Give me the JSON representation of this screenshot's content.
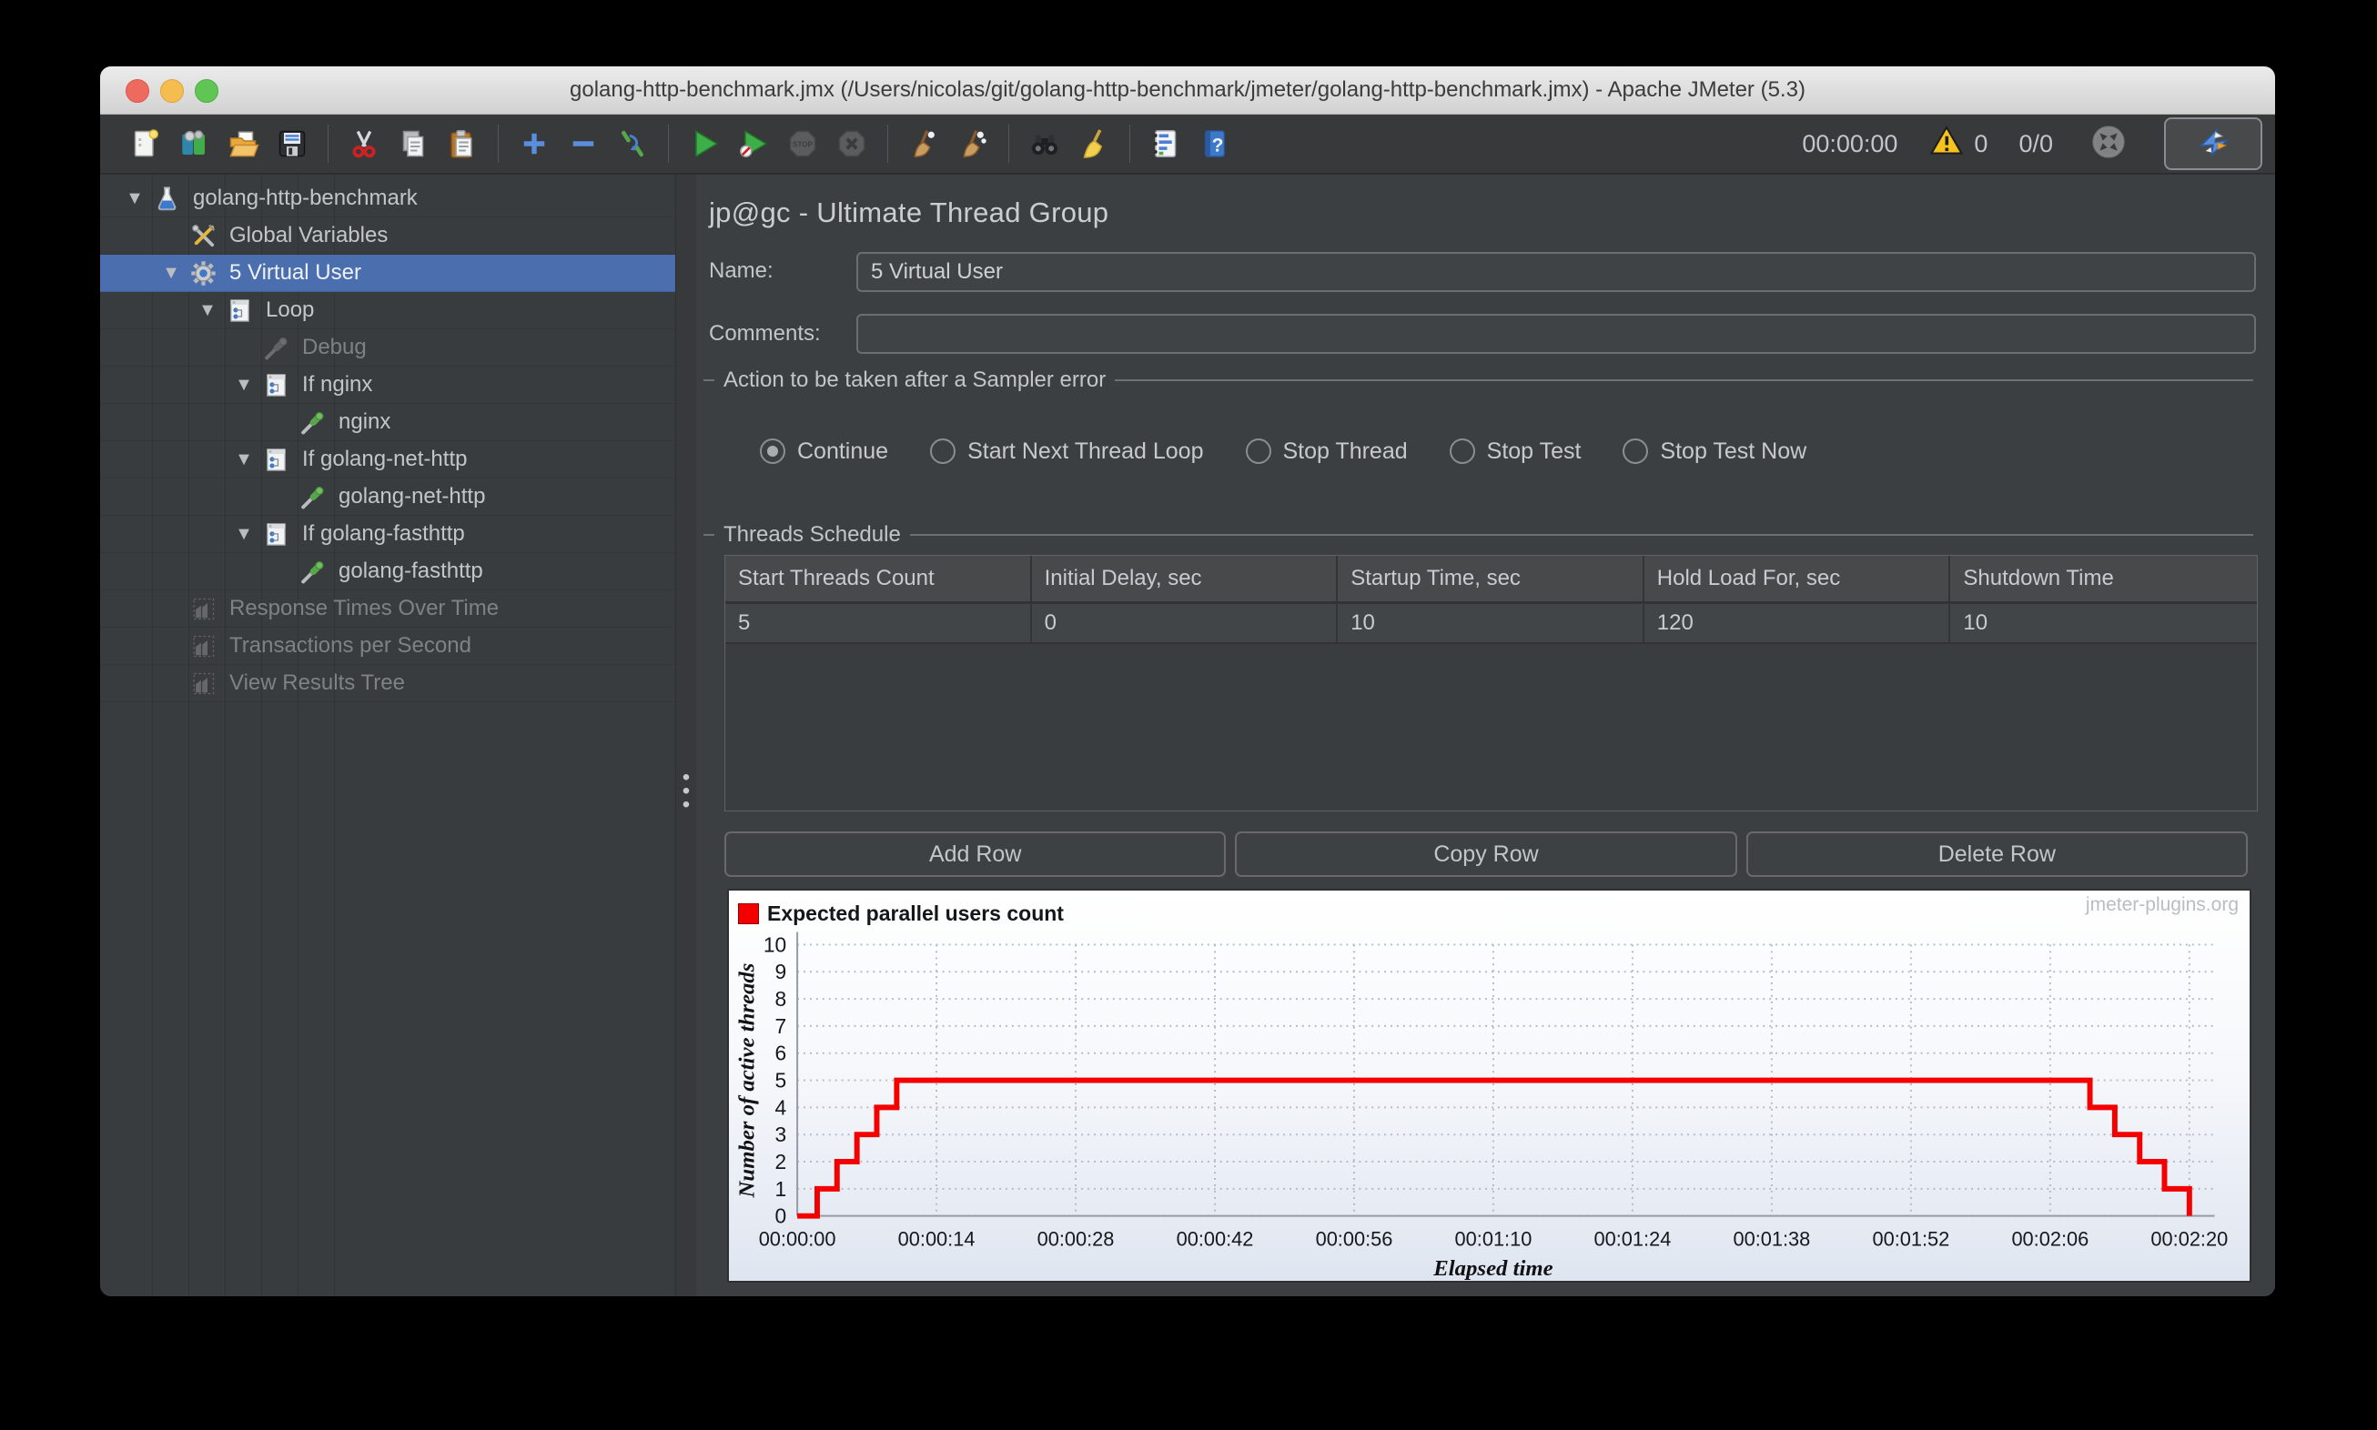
{
  "window": {
    "title": "golang-http-benchmark.jmx (/Users/nicolas/git/golang-http-benchmark/jmeter/golang-http-benchmark.jmx) - Apache JMeter (5.3)"
  },
  "toolbar": {
    "groups": [
      [
        {
          "name": "new-file"
        },
        {
          "name": "templates"
        },
        {
          "name": "open-file"
        },
        {
          "name": "save"
        }
      ],
      [
        {
          "name": "cut"
        },
        {
          "name": "copy"
        },
        {
          "name": "paste"
        }
      ],
      [
        {
          "name": "add"
        },
        {
          "name": "remove"
        },
        {
          "name": "toggle"
        }
      ],
      [
        {
          "name": "start"
        },
        {
          "name": "start-no-timers"
        },
        {
          "name": "stop",
          "disabled": true
        },
        {
          "name": "shutdown",
          "disabled": true
        }
      ],
      [
        {
          "name": "clear"
        },
        {
          "name": "clear-all"
        }
      ],
      [
        {
          "name": "search"
        },
        {
          "name": "search-reset"
        }
      ],
      [
        {
          "name": "function-helper"
        },
        {
          "name": "help"
        }
      ]
    ],
    "timer": "00:00:00",
    "warning_count": "0",
    "thread_counts": "0/0"
  },
  "tree": {
    "items": [
      {
        "label": "golang-http-benchmark",
        "icon": "test-plan-icon",
        "depth": 0,
        "expandable": true
      },
      {
        "label": "Global Variables",
        "icon": "arguments-icon",
        "depth": 1
      },
      {
        "label": "5 Virtual User",
        "icon": "thread-group-icon",
        "depth": 1,
        "expandable": true,
        "selected": true
      },
      {
        "label": "Loop",
        "icon": "controller-icon",
        "depth": 2,
        "expandable": true
      },
      {
        "label": "Debug",
        "icon": "sampler-disabled-icon",
        "depth": 3,
        "disabled": true
      },
      {
        "label": "If nginx",
        "icon": "controller-icon",
        "depth": 3,
        "expandable": true
      },
      {
        "label": "nginx",
        "icon": "sampler-icon",
        "depth": 4
      },
      {
        "label": "If golang-net-http",
        "icon": "controller-icon",
        "depth": 3,
        "expandable": true
      },
      {
        "label": "golang-net-http",
        "icon": "sampler-icon",
        "depth": 4
      },
      {
        "label": "If golang-fasthttp",
        "icon": "controller-icon",
        "depth": 3,
        "expandable": true
      },
      {
        "label": "golang-fasthttp",
        "icon": "sampler-icon",
        "depth": 4
      },
      {
        "label": "Response Times Over Time",
        "icon": "listener-icon",
        "depth": 1,
        "disabled": true
      },
      {
        "label": "Transactions per Second",
        "icon": "listener-icon",
        "depth": 1,
        "disabled": true
      },
      {
        "label": "View Results Tree",
        "icon": "listener-icon",
        "depth": 1,
        "disabled": true
      }
    ]
  },
  "main": {
    "header": "jp@gc - Ultimate Thread Group",
    "name": {
      "label": "Name:",
      "value": "5 Virtual User"
    },
    "comments": {
      "label": "Comments:",
      "value": ""
    },
    "sampler_error": {
      "title": "Action to be taken after a Sampler error",
      "options": [
        {
          "label": "Continue",
          "selected": true
        },
        {
          "label": "Start Next Thread Loop",
          "selected": false
        },
        {
          "label": "Stop Thread",
          "selected": false
        },
        {
          "label": "Stop Test",
          "selected": false
        },
        {
          "label": "Stop Test Now",
          "selected": false
        }
      ]
    },
    "schedule": {
      "title": "Threads Schedule",
      "columns": [
        "Start Threads Count",
        "Initial Delay, sec",
        "Startup Time, sec",
        "Hold Load For, sec",
        "Shutdown Time"
      ],
      "rows": [
        [
          "5",
          "0",
          "10",
          "120",
          "10"
        ]
      ]
    },
    "buttons": [
      {
        "label": "Add Row"
      },
      {
        "label": "Copy Row"
      },
      {
        "label": "Delete Row"
      }
    ]
  },
  "chart_data": {
    "type": "line",
    "subtype": "step",
    "watermark": "jmeter-plugins.org",
    "xlabel": "Elapsed time",
    "ylabel": "Number of active threads",
    "xlim": [
      0,
      140
    ],
    "ylim": [
      0,
      10
    ],
    "yticks": [
      0,
      1,
      2,
      3,
      4,
      5,
      6,
      7,
      8,
      9,
      10
    ],
    "xticks": [
      {
        "t": 0,
        "label": "00:00:00"
      },
      {
        "t": 14,
        "label": "00:00:14"
      },
      {
        "t": 28,
        "label": "00:00:28"
      },
      {
        "t": 42,
        "label": "00:00:42"
      },
      {
        "t": 56,
        "label": "00:00:56"
      },
      {
        "t": 70,
        "label": "00:01:10"
      },
      {
        "t": 84,
        "label": "00:01:24"
      },
      {
        "t": 98,
        "label": "00:01:38"
      },
      {
        "t": 112,
        "label": "00:01:52"
      },
      {
        "t": 126,
        "label": "00:02:06"
      },
      {
        "t": 140,
        "label": "00:02:20"
      }
    ],
    "grid": true,
    "legend_position": "top-left",
    "series": [
      {
        "name": "Expected parallel users count",
        "color": "#f40000",
        "points": [
          [
            0,
            0
          ],
          [
            2,
            0
          ],
          [
            2,
            1
          ],
          [
            4,
            1
          ],
          [
            4,
            2
          ],
          [
            6,
            2
          ],
          [
            6,
            3
          ],
          [
            8,
            3
          ],
          [
            8,
            4
          ],
          [
            10,
            4
          ],
          [
            10,
            5
          ],
          [
            130,
            5
          ],
          [
            130,
            4
          ],
          [
            132.5,
            4
          ],
          [
            132.5,
            3
          ],
          [
            135,
            3
          ],
          [
            135,
            2
          ],
          [
            137.5,
            2
          ],
          [
            137.5,
            1
          ],
          [
            140,
            1
          ],
          [
            140,
            0
          ]
        ]
      }
    ]
  }
}
